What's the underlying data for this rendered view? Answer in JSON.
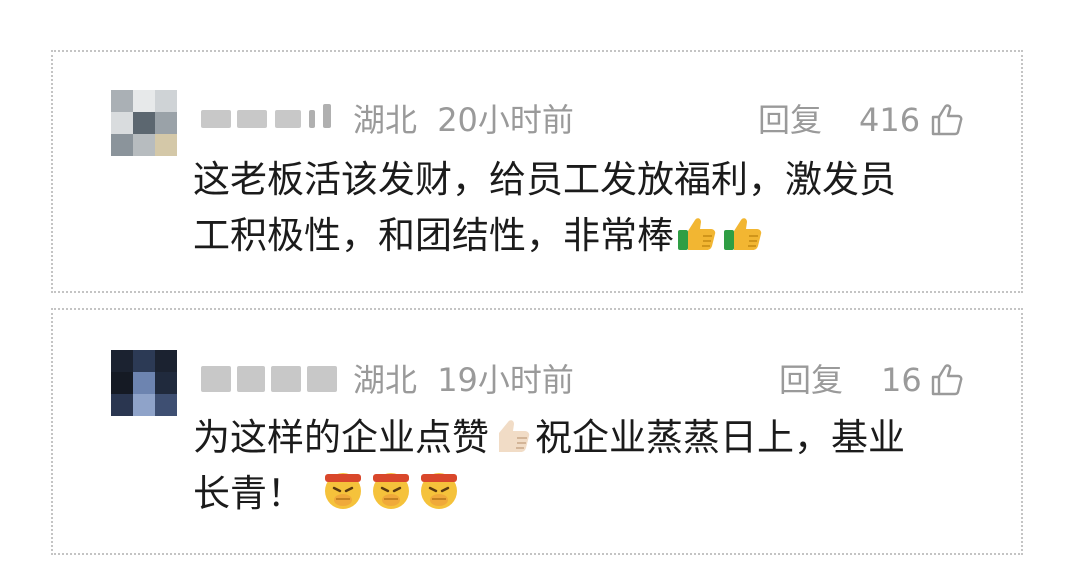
{
  "comments": [
    {
      "location": "湖北",
      "time": "20小时前",
      "reply_label": "回复",
      "likes": "416",
      "line1": "这老板活该发财，给员工发放福利，激发员",
      "line2": "工积极性，和团结性，非常棒",
      "emojis": [
        "thumbs-up-icon",
        "thumbs-up-icon"
      ]
    },
    {
      "location": "湖北",
      "time": "19小时前",
      "reply_label": "回复",
      "likes": "16",
      "line1_a": "为这样的企业点赞",
      "line1_b": "祝企业蒸蒸日上，基业",
      "line2": "长青！",
      "emojis": [
        "thumbs-up-icon",
        "fighting-face-icon",
        "fighting-face-icon",
        "fighting-face-icon"
      ]
    }
  ],
  "colors": {
    "meta_gray": "#9a9a9a",
    "text": "#1b1b1b",
    "border": "#c4c4c4"
  }
}
